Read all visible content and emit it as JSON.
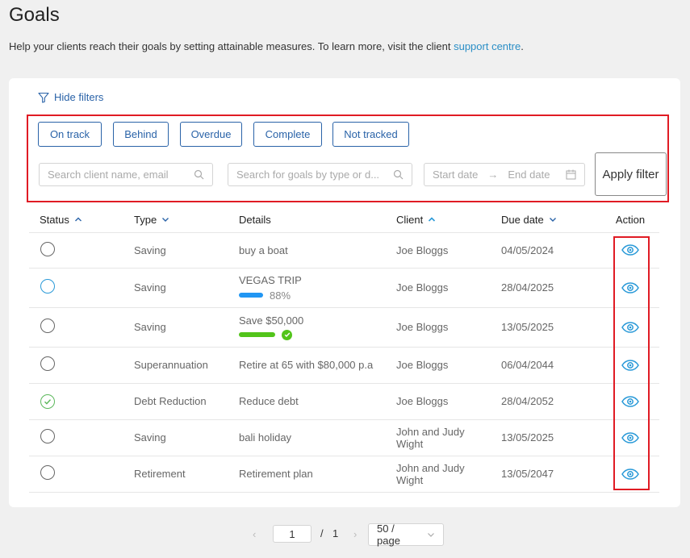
{
  "page": {
    "title": "Goals",
    "intro_text": "Help your clients reach their goals by setting attainable measures. To learn more, visit the client ",
    "intro_link": "support centre",
    "intro_end": "."
  },
  "filters": {
    "toggle_label": "Hide filters",
    "chips": [
      "On track",
      "Behind",
      "Overdue",
      "Complete",
      "Not tracked"
    ],
    "client_search_placeholder": "Search client name, email",
    "goal_search_placeholder": "Search for goals by type or d...",
    "start_date_placeholder": "Start date",
    "end_date_placeholder": "End date",
    "apply_label": "Apply filter"
  },
  "table": {
    "headers": {
      "status": "Status",
      "type": "Type",
      "details": "Details",
      "client": "Client",
      "due_date": "Due date",
      "action": "Action"
    },
    "rows": [
      {
        "status": "empty",
        "type": "Saving",
        "details": "buy a boat",
        "client": "Joe Bloggs",
        "due_date": "04/05/2024"
      },
      {
        "status": "blue",
        "type": "Saving",
        "details": "VEGAS TRIP",
        "progress_percent": 88,
        "progress_label": "88%",
        "client": "Joe Bloggs",
        "due_date": "28/04/2025"
      },
      {
        "status": "empty",
        "type": "Saving",
        "details": "Save $50,000",
        "progress_percent": 100,
        "client": "Joe Bloggs",
        "due_date": "13/05/2025"
      },
      {
        "status": "empty",
        "type": "Superannuation",
        "details": "Retire at 65 with $80,000 p.a",
        "client": "Joe Bloggs",
        "due_date": "06/04/2044"
      },
      {
        "status": "complete",
        "type": "Debt Reduction",
        "details": "Reduce debt",
        "client": "Joe Bloggs",
        "due_date": "28/04/2052"
      },
      {
        "status": "empty",
        "type": "Saving",
        "details": "bali holiday",
        "client": "John and Judy Wight",
        "due_date": "13/05/2025"
      },
      {
        "status": "empty",
        "type": "Retirement",
        "details": "Retirement plan",
        "client": "John and Judy Wight",
        "due_date": "13/05/2047"
      }
    ]
  },
  "pagination": {
    "current_page": "1",
    "separator": "/",
    "total_pages": "1",
    "page_size": "50 / page"
  },
  "colors": {
    "accent_blue": "#2a63a8",
    "link_blue": "#2a8ec6",
    "eye_icon": "#2a9ad8",
    "highlight_red": "#e01b24",
    "progress_blue": "#2196f3",
    "progress_green": "#52c41a"
  }
}
